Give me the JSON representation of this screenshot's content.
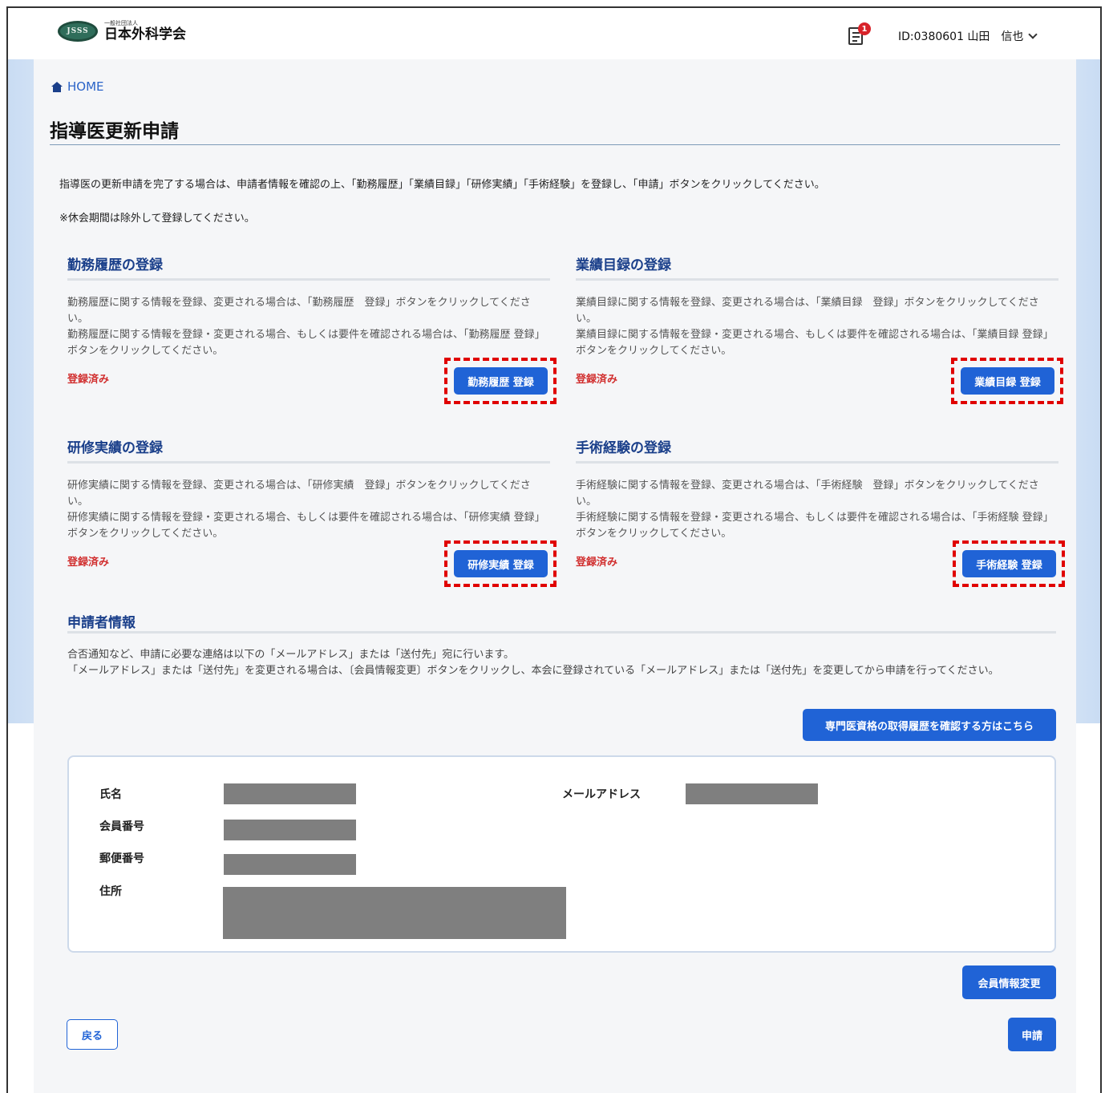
{
  "header": {
    "logo_mark": "JSSS",
    "logo_subtitle": "一般社団法人",
    "logo_name": "日本外科学会",
    "notification_count": "1",
    "user_label": "ID:0380601 山田　信也",
    "icons": {
      "notifications": "document-icon",
      "user_menu": "chevron-down-icon",
      "home": "home-icon"
    }
  },
  "breadcrumb": {
    "home": "HOME"
  },
  "page": {
    "title": "指導医更新申請",
    "intro": "指導医の更新申請を完了する場合は、申請者情報を確認の上、「勤務履歴」「業績目録」「研修実績」「手術経験」を登録し、「申請」ボタンをクリックしてください。",
    "note": "※休会期間は除外して登録してください。"
  },
  "sections": [
    {
      "title": "勤務履歴の登録",
      "desc1": "勤務履歴に関する情報を登録、変更される場合は、「勤務履歴　登録」ボタンをクリックしてください。",
      "desc2": "勤務履歴に関する情報を登録・変更される場合、もしくは要件を確認される場合は、「勤務履歴 登録」ボタンをクリックしてください。",
      "status": "登録済み",
      "button": "勤務履歴 登録"
    },
    {
      "title": "業績目録の登録",
      "desc1": "業績目録に関する情報を登録、変更される場合は、「業績目録　登録」ボタンをクリックしてください。",
      "desc2": "業績目録に関する情報を登録・変更される場合、もしくは要件を確認される場合は、「業績目録 登録」ボタンをクリックしてください。",
      "status": "登録済み",
      "button": "業績目録 登録"
    },
    {
      "title": "研修実績の登録",
      "desc1": "研修実績に関する情報を登録、変更される場合は、「研修実績　登録」ボタンをクリックしてください。",
      "desc2": "研修実績に関する情報を登録・変更される場合、もしくは要件を確認される場合は、「研修実績 登録」ボタンをクリックしてください。",
      "status": "登録済み",
      "button": "研修実績 登録"
    },
    {
      "title": "手術経験の登録",
      "desc1": "手術経験に関する情報を登録、変更される場合は、「手術経験　登録」ボタンをクリックしてください。",
      "desc2": "手術経験に関する情報を登録・変更される場合、もしくは要件を確認される場合は、「手術経験 登録」ボタンをクリックしてください。",
      "status": "登録済み",
      "button": "手術経験 登録"
    }
  ],
  "applicant": {
    "title": "申請者情報",
    "desc1": "合否通知など、申請に必要な連絡は以下の「メールアドレス」または「送付先」宛に行います。",
    "desc2": "「メールアドレス」または「送付先」を変更される場合は、〔会員情報変更〕ボタンをクリックし、本会に登録されている「メールアドレス」または「送付先」を変更してから申請を行ってください。",
    "history_button": "専門医資格の取得履歴を確認する方はこちら",
    "labels": {
      "name": "氏名",
      "member_no": "会員番号",
      "postal": "郵便番号",
      "address": "住所",
      "email": "メールアドレス"
    }
  },
  "buttons": {
    "member_change": "会員情報変更",
    "back": "戻る",
    "apply": "申請"
  },
  "colors": {
    "primary": "#2063d6",
    "heading": "#1a3f8a",
    "status": "#d12f2f",
    "highlight": "#e00000",
    "badge": "#d8232a"
  }
}
